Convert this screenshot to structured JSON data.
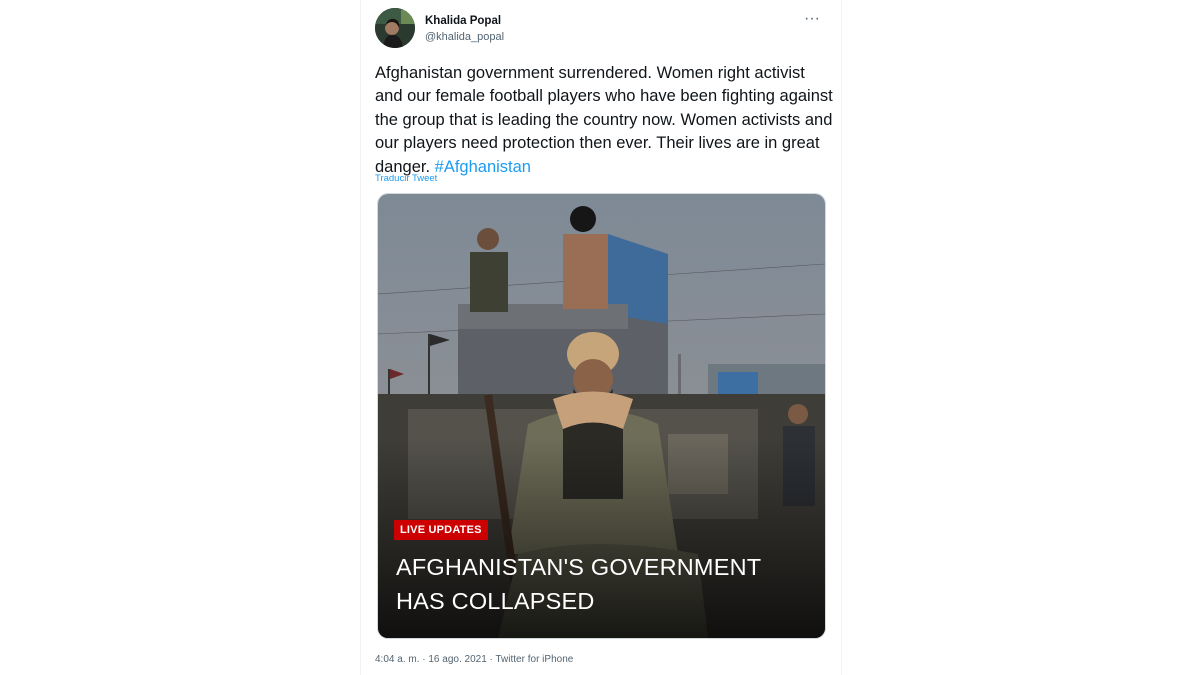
{
  "author": {
    "display_name": "Khalida Popal",
    "handle": "@khalida_popal",
    "avatar_icon": "profile-photo"
  },
  "tweet": {
    "text": "Afghanistan government surrendered. Women right activist and our female football players who have been fighting against the group that is leading the country now. Women activists and our players need protection then ever. Their lives are in great danger.",
    "hashtag": "#Afghanistan",
    "translate_label": "Traducir Tweet",
    "more_icon": "more-horizontal-icon"
  },
  "media": {
    "badge": "LIVE UPDATES",
    "headline": "AFGHANISTAN'S GOVERNMENT HAS COLLAPSED"
  },
  "footer": {
    "time": "4:04 a. m.",
    "separator": "·",
    "date": "16 ago. 2021",
    "source": "Twitter for iPhone"
  },
  "colors": {
    "link": "#1d9bf0",
    "badge": "#cc0000",
    "text": "#0f1419",
    "secondary": "#536471"
  }
}
